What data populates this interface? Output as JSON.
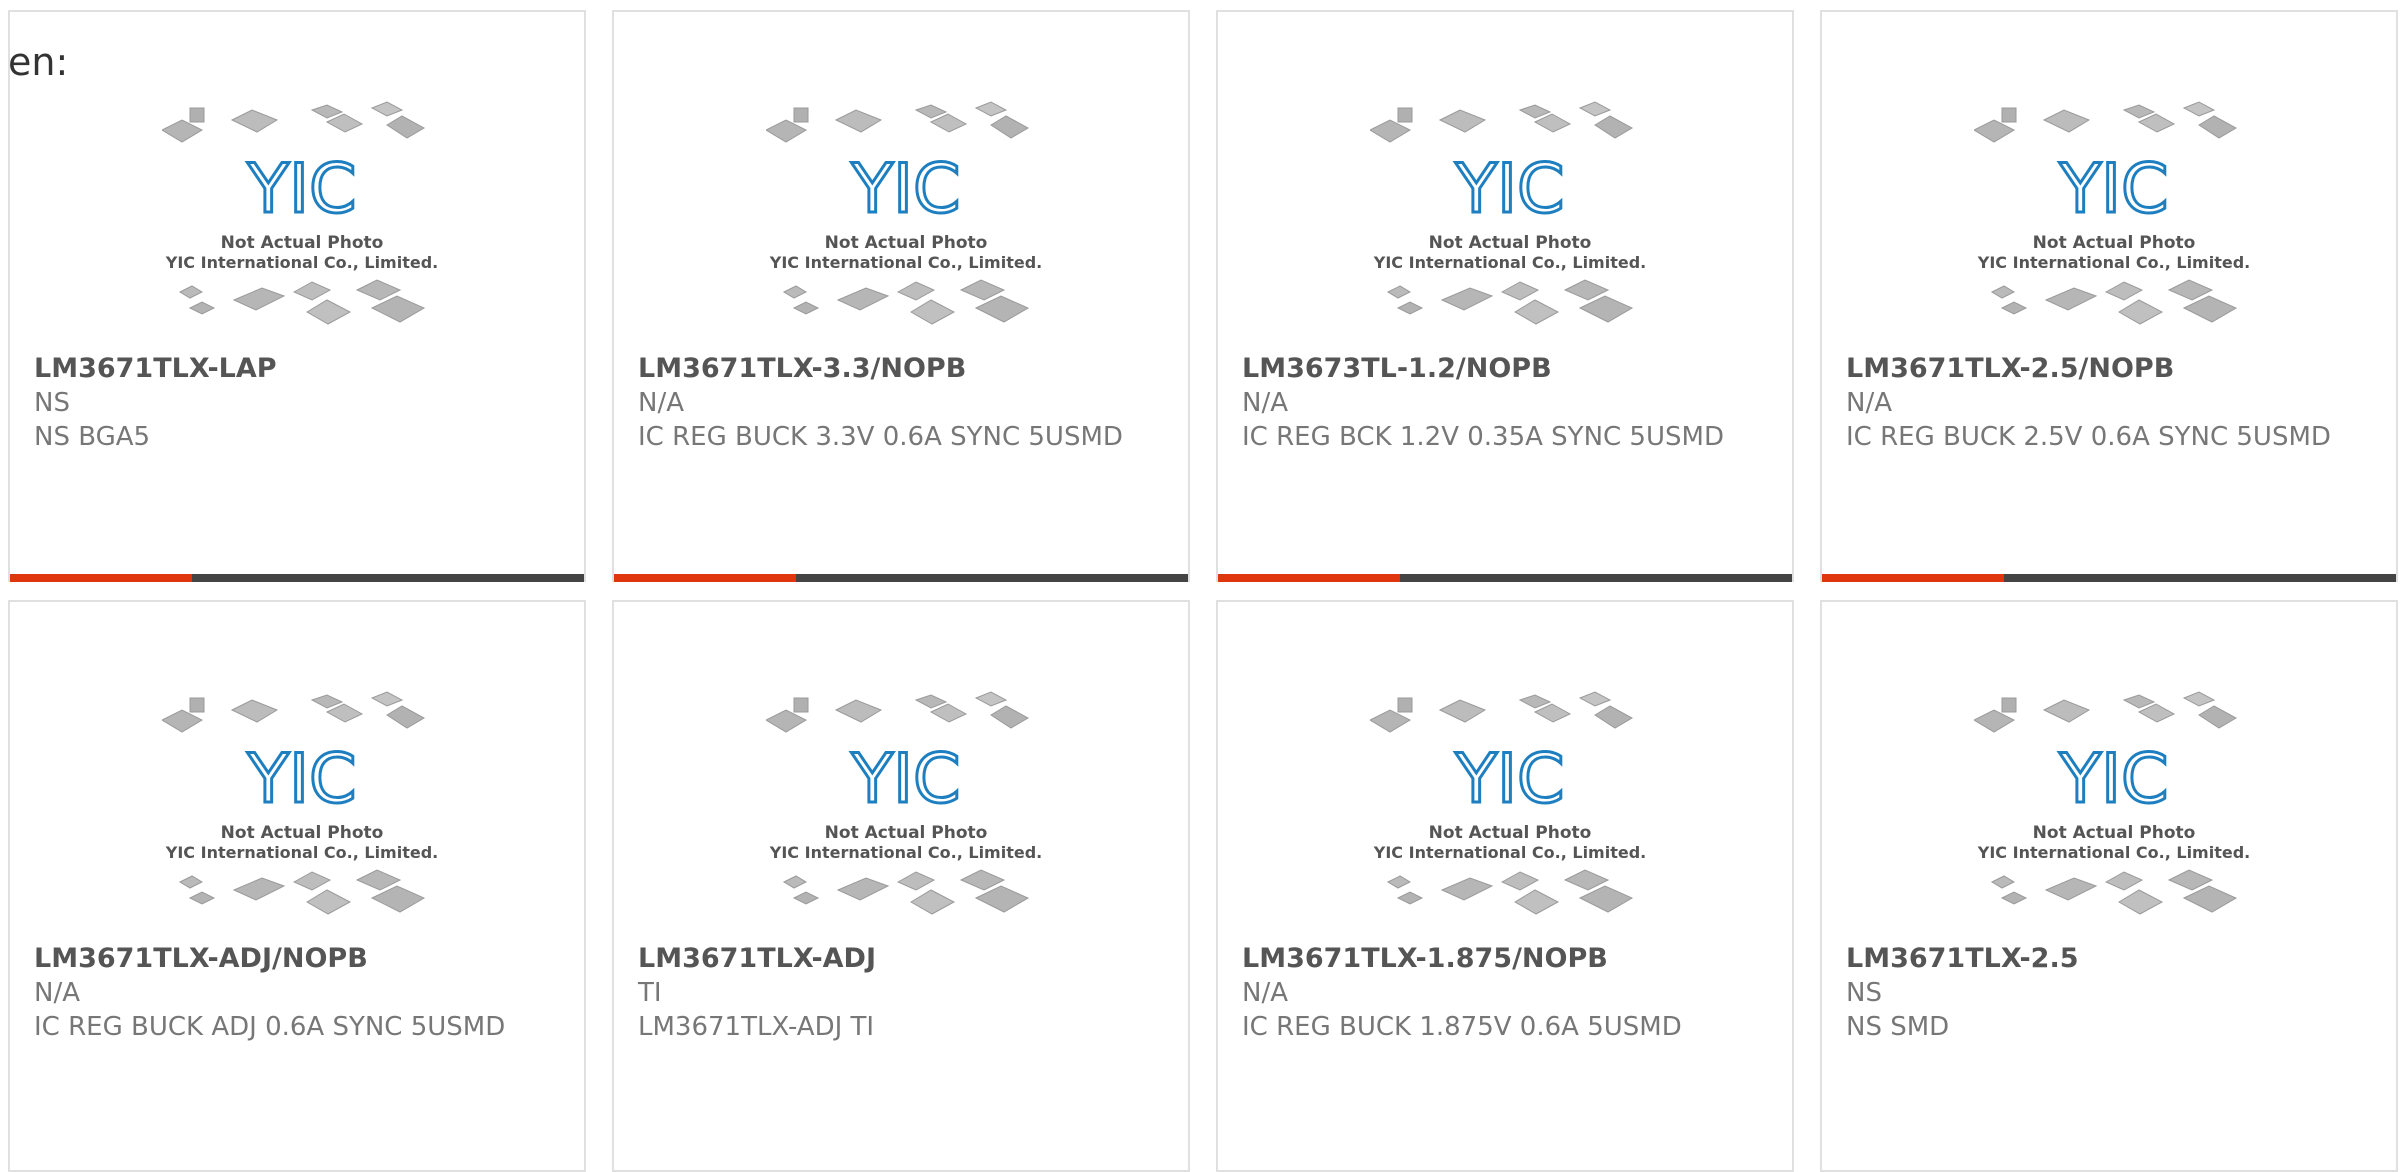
{
  "lang_label": "en:",
  "photo": {
    "logo_text": "YIC",
    "caption_line1": "Not Actual Photo",
    "caption_line2": "YIC International Co., Limited.",
    "logo_color": "#1e7fc0"
  },
  "accent_color": "#e0360f",
  "products": [
    {
      "part": "LM3671TLX-LAP",
      "maker": "NS",
      "desc": "NS BGA5"
    },
    {
      "part": "LM3671TLX-3.3/NOPB",
      "maker": "N/A",
      "desc": "IC REG BUCK 3.3V 0.6A SYNC 5USMD"
    },
    {
      "part": "LM3673TL-1.2/NOPB",
      "maker": "N/A",
      "desc": "IC REG BCK 1.2V 0.35A SYNC 5USMD"
    },
    {
      "part": "LM3671TLX-2.5/NOPB",
      "maker": "N/A",
      "desc": "IC REG BUCK 2.5V 0.6A SYNC 5USMD"
    },
    {
      "part": "LM3671TLX-ADJ/NOPB",
      "maker": "N/A",
      "desc": "IC REG BUCK ADJ 0.6A SYNC 5USMD"
    },
    {
      "part": "LM3671TLX-ADJ",
      "maker": "TI",
      "desc": "LM3671TLX-ADJ TI"
    },
    {
      "part": "LM3671TLX-1.875/NOPB",
      "maker": "N/A",
      "desc": "IC REG BUCK 1.875V 0.6A 5USMD"
    },
    {
      "part": "LM3671TLX-2.5",
      "maker": "NS",
      "desc": "NS SMD"
    }
  ]
}
